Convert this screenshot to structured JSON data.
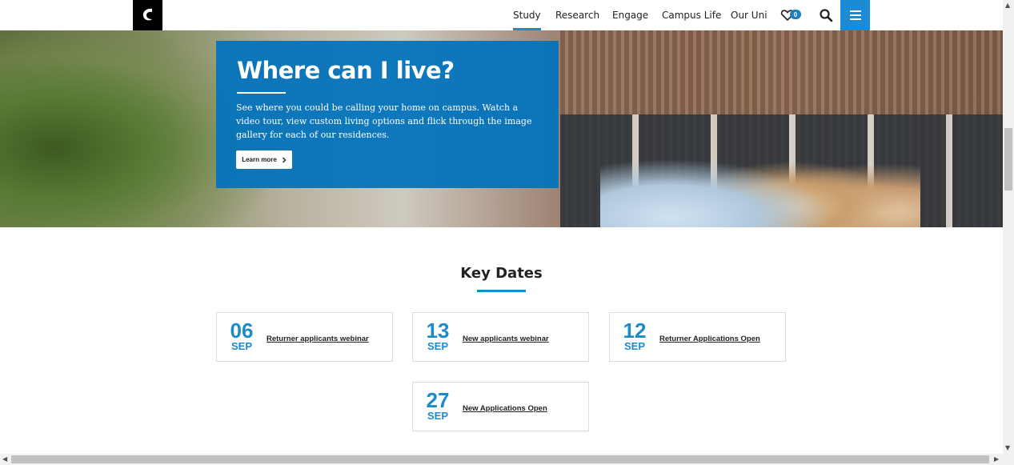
{
  "header": {
    "nav": [
      {
        "label": "Study",
        "active": true
      },
      {
        "label": "Research",
        "active": false
      },
      {
        "label": "Engage",
        "active": false
      },
      {
        "label": "Campus Life",
        "active": false
      },
      {
        "label": "Our Uni",
        "active": false
      }
    ],
    "favourites_count": "0",
    "icons": [
      "university-logo-icon",
      "heart-icon",
      "search-icon",
      "hamburger-menu-icon"
    ]
  },
  "hero": {
    "title": "Where can I live?",
    "text": "See where you could be calling your home on campus. Watch a video tour, view custom living options and flick through the image gallery for each of our residences.",
    "button_label": "Learn more"
  },
  "key_dates": {
    "title": "Key Dates",
    "items": [
      {
        "day": "06",
        "month": "SEP",
        "label": "Returner applicants webinar"
      },
      {
        "day": "13",
        "month": "SEP",
        "label": "New applicants webinar"
      },
      {
        "day": "12",
        "month": "SEP",
        "label": "Returner Applications Open"
      },
      {
        "day": "27",
        "month": "SEP",
        "label": "New Applications Open"
      }
    ]
  },
  "colors": {
    "accent": "#1b8bcc",
    "hero_card": "#0072bc",
    "menu_button": "#1b8bd6"
  }
}
